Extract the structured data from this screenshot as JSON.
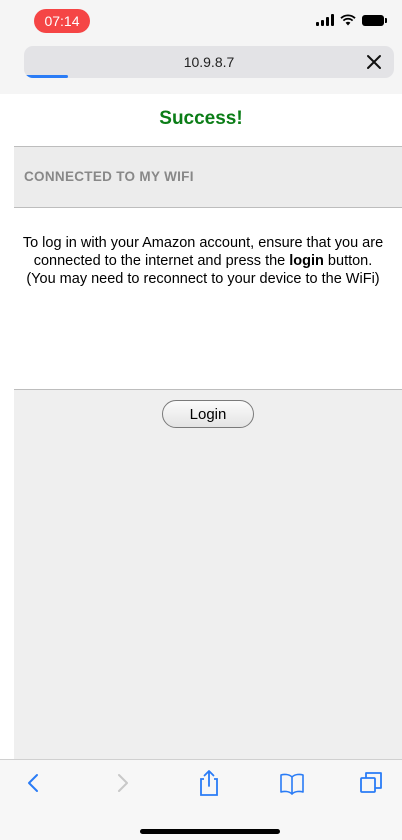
{
  "status_bar": {
    "time": "07:14",
    "time_pill_color": "#f54545",
    "icons": [
      "signal-icon",
      "wifi-icon",
      "battery-icon"
    ]
  },
  "browser": {
    "url": "10.9.8.7",
    "close_icon": "close-icon",
    "accent_color": "#2a7cf6"
  },
  "page": {
    "title": "Success!",
    "title_color": "#0b7d17",
    "section_heading": "CONNECTED TO MY WIFI",
    "info": {
      "line_prefix": "To log in with your Amazon account, ensure that you are connected to the internet and press the ",
      "bold_word": "login",
      "line_suffix": " button.",
      "note": "(You may need to reconnect to your device to the WiFi)"
    },
    "login_button_label": "Login"
  },
  "toolbar": {
    "items": [
      "back-icon",
      "forward-icon",
      "share-icon",
      "bookmarks-icon",
      "tabs-icon"
    ]
  }
}
